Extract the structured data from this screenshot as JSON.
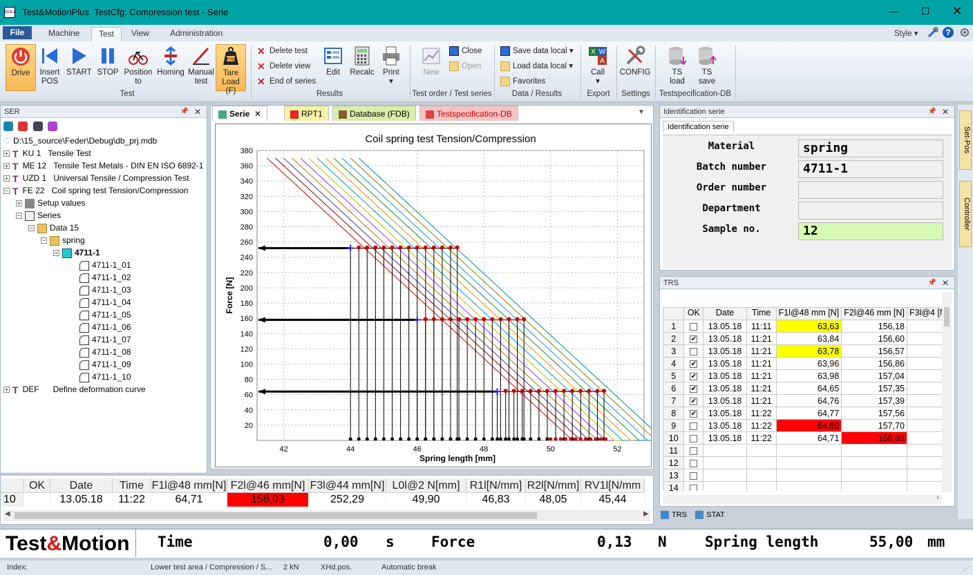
{
  "window": {
    "app": "Test&MotionPlus",
    "title": "TestCfg: Compression test - Serie",
    "app_icon": "DOLI"
  },
  "menu": {
    "file": "File",
    "tabs": [
      "Machine",
      "Test",
      "View",
      "Administration"
    ],
    "right_style": "Style"
  },
  "ribbon": {
    "test_group": {
      "label": "Test",
      "buttons": [
        {
          "label1": "Drive",
          "label2": ""
        },
        {
          "label1": "Insert",
          "label2": "POS"
        },
        {
          "label1": "START",
          "label2": ""
        },
        {
          "label1": "STOP",
          "label2": ""
        },
        {
          "label1": "Position",
          "label2": "to"
        },
        {
          "label1": "Homing",
          "label2": ""
        },
        {
          "label1": "Manual",
          "label2": "test"
        },
        {
          "label1": "Tare",
          "label2": "Load (F)"
        }
      ]
    },
    "results_group": {
      "label": "Results",
      "small": [
        "Delete test",
        "Delete view",
        "End of series"
      ],
      "edit": "Edit",
      "recalc": "Recalc",
      "print": "Print"
    },
    "testorder_group": {
      "label": "Test order / Test series",
      "new": "New",
      "close": "Close",
      "open": "Open"
    },
    "data_group": {
      "label": "Data / Results",
      "items": [
        "Save data local",
        "Load data local",
        "Favorites"
      ]
    },
    "export_group": {
      "label": "Export",
      "call": "Call"
    },
    "settings_group": {
      "label": "Settings",
      "config": "CONFIG"
    },
    "tsdb_group": {
      "label": "Testspecification-DB",
      "ts_load1": "TS",
      "ts_load2": "load",
      "ts_save1": "TS",
      "ts_save2": "save"
    },
    "tare_icon_text": "F=0"
  },
  "ser_panel": {
    "title": "SER",
    "path": "D:\\15_source\\Feder\\Debug\\db_prj.mdb",
    "tests": [
      {
        "code": "KU 1",
        "name": "Tensile Test"
      },
      {
        "code": "ME 12",
        "name": "Tensile Test Metals - DIN EN ISO 6892-1"
      },
      {
        "code": "UZD 1",
        "name": "Universal Tensile / Compression Test"
      },
      {
        "code": "FE 22",
        "name": "Coil spring test Tension/Compression"
      }
    ],
    "setup": "Setup values",
    "series": "Series",
    "data": "Data 15",
    "material": "spring",
    "batch": "4711-1",
    "samples": [
      "4711-1_01",
      "4711-1_02",
      "4711-1_03",
      "4711-1_04",
      "4711-1_05",
      "4711-1_06",
      "4711-1_07",
      "4711-1_08",
      "4711-1_09",
      "4711-1_10"
    ],
    "def": {
      "code": "DEF",
      "name": "Define deformation curve"
    }
  },
  "doc_tabs": [
    "Serie",
    "RPT1",
    "Database (FDB)",
    "Testspecification-DB"
  ],
  "chart_data": {
    "type": "line",
    "title": "Coil spring test Tension/Compression",
    "xlabel": "Spring length [mm]",
    "ylabel": "Force [N]",
    "xlim": [
      41.2,
      52.8
    ],
    "ylim": [
      0,
      380
    ],
    "xticks": [
      42,
      44,
      46,
      48,
      50,
      52
    ],
    "yticks": [
      20,
      40,
      60,
      80,
      100,
      120,
      140,
      160,
      180,
      200,
      220,
      240,
      260,
      280,
      300,
      320,
      340,
      360,
      380
    ],
    "grid": true,
    "series_colors": [
      "#d00000",
      "#8b0000",
      "#3a3a9a",
      "#b07b00",
      "#9b30ff",
      "#c0c000",
      "#00a0a0",
      "#ff8c00",
      "#228b22",
      "#1e90ff",
      "#808000",
      "#008b8b"
    ],
    "series_offsets_mm": [
      0,
      0.25,
      0.5,
      0.75,
      1.0,
      1.25,
      1.5,
      1.75,
      2.0,
      2.25,
      2.5,
      2.75
    ],
    "line_start": {
      "x": 41.5,
      "y": 370
    },
    "line_slope_n_per_mm": -40.4,
    "top_cap": 374,
    "levels_N": [
      252,
      158,
      64
    ],
    "level_markers_x": {
      "252": [
        44.0,
        44.25,
        44.5,
        44.75,
        45.0,
        45.25,
        45.5,
        45.75,
        46.0,
        46.25,
        46.5,
        46.75,
        47.0,
        47.2
      ],
      "158": [
        46.0,
        46.25,
        46.5,
        46.75,
        47.0,
        47.25,
        47.5,
        47.75,
        48.0,
        48.25,
        48.5,
        48.75,
        49.0,
        49.2
      ],
      "64": [
        48.4,
        48.65,
        48.9,
        49.15,
        49.4,
        49.65,
        49.9,
        50.15,
        50.4,
        50.65,
        50.9,
        51.15,
        51.4,
        51.6
      ]
    }
  },
  "bottom_grid": {
    "headers": [
      "OK",
      "Date",
      "Time",
      "F1l@48 mm[N]",
      "F2l@46 mm[N]",
      "F3l@44 mm[N]",
      "L0l@2 N[mm]",
      "R1l[N/mm]",
      "R2l[N/mm]",
      "RV1l[N/mm"
    ],
    "row": [
      "10",
      "",
      "13.05.18",
      "11:22",
      "64,71",
      "158,03",
      "252,29",
      "49,90",
      "46,83",
      "48,05",
      "45,44"
    ]
  },
  "id_panel": {
    "title": "Identification serie",
    "tab": "Identification serie",
    "fields": [
      {
        "label": "Material",
        "value": "spring"
      },
      {
        "label": "Batch number",
        "value": "4711-1"
      },
      {
        "label": "Order number",
        "value": ""
      },
      {
        "label": "Department",
        "value": ""
      },
      {
        "label": "Sample no.",
        "value": "12"
      }
    ]
  },
  "trs": {
    "title": "TRS",
    "headers": [
      "OK",
      "Date",
      "Time",
      "F1l@48 mm [N]",
      "F2l@46 mm [N]",
      "F3l@4 [N"
    ],
    "rows": [
      {
        "n": "1",
        "ok": false,
        "date": "13.05.18",
        "time": "11:11",
        "f1": "63,63",
        "f2": "156,18",
        "f1c": "yel",
        "f2c": ""
      },
      {
        "n": "2",
        "ok": true,
        "date": "13.05.18",
        "time": "11:21",
        "f1": "63,84",
        "f2": "156,60",
        "f1c": "",
        "f2c": ""
      },
      {
        "n": "3",
        "ok": false,
        "date": "13.05.18",
        "time": "11:21",
        "f1": "63,78",
        "f2": "156,57",
        "f1c": "yel",
        "f2c": ""
      },
      {
        "n": "4",
        "ok": true,
        "date": "13.05.18",
        "time": "11:21",
        "f1": "63,96",
        "f2": "156,86",
        "f1c": "",
        "f2c": ""
      },
      {
        "n": "5",
        "ok": true,
        "date": "13.05.18",
        "time": "11:21",
        "f1": "63,98",
        "f2": "157,04",
        "f1c": "",
        "f2c": ""
      },
      {
        "n": "6",
        "ok": true,
        "date": "13.05.18",
        "time": "11:21",
        "f1": "64,65",
        "f2": "157,35",
        "f1c": "",
        "f2c": ""
      },
      {
        "n": "7",
        "ok": true,
        "date": "13.05.18",
        "time": "11:21",
        "f1": "64,76",
        "f2": "157,39",
        "f1c": "",
        "f2c": ""
      },
      {
        "n": "8",
        "ok": true,
        "date": "13.05.18",
        "time": "11:22",
        "f1": "64,77",
        "f2": "157,56",
        "f1c": "",
        "f2c": ""
      },
      {
        "n": "9",
        "ok": false,
        "date": "13.05.18",
        "time": "11:22",
        "f1": "64,80",
        "f2": "157,70",
        "f1c": "red",
        "f2c": ""
      },
      {
        "n": "10",
        "ok": false,
        "date": "13.05.18",
        "time": "11:22",
        "f1": "64,71",
        "f2": "158,03",
        "f1c": "",
        "f2c": "red"
      },
      {
        "n": "11",
        "ok": false,
        "date": "",
        "time": "",
        "f1": "",
        "f2": "",
        "f1c": "",
        "f2c": ""
      },
      {
        "n": "12",
        "ok": false,
        "date": "",
        "time": "",
        "f1": "",
        "f2": "",
        "f1c": "",
        "f2c": ""
      },
      {
        "n": "13",
        "ok": false,
        "date": "",
        "time": "",
        "f1": "",
        "f2": "",
        "f1c": "",
        "f2c": ""
      },
      {
        "n": "14",
        "ok": false,
        "date": "",
        "time": "",
        "f1": "",
        "f2": "",
        "f1c": "",
        "f2c": ""
      }
    ],
    "bottom_tabs": [
      "TRS",
      "STAT"
    ]
  },
  "side_tabs": [
    "Set-Pos",
    "Controller"
  ],
  "live": {
    "logo_a": "Test",
    "logo_amp": "&",
    "logo_b": "Motion",
    "time_label": "Time",
    "time_val": "0,00",
    "time_unit": "s",
    "force_label": "Force",
    "force_val": "0,13",
    "force_unit": "N",
    "len_label": "Spring length",
    "len_val": "55,00",
    "len_unit": "mm"
  },
  "status": {
    "index": "Index:",
    "area": "Lower test area / Compression / S...",
    "range": "2 kN",
    "pos": "XHd.pos.",
    "brk": "Automatic break"
  }
}
